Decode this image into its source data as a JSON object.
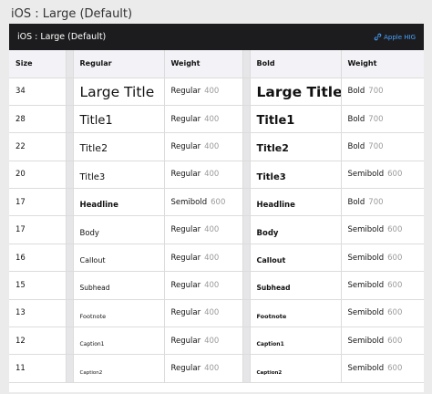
{
  "page_title": "iOS : Large (Default)",
  "header": {
    "title": "iOS : Large (Default)",
    "link_label": "Apple HIG"
  },
  "columns": {
    "size": "Size",
    "regular": "Regular",
    "weight": "Weight",
    "bold": "Bold",
    "bold_weight": "Weight"
  },
  "rows": [
    {
      "size": "34",
      "regular": "Large Title",
      "regular_weight": "Regular",
      "regular_weight_num": "400",
      "bold": "Large Title",
      "bold_weight": "Bold",
      "bold_weight_num": "700"
    },
    {
      "size": "28",
      "regular": "Title1",
      "regular_weight": "Regular",
      "regular_weight_num": "400",
      "bold": "Title1",
      "bold_weight": "Bold",
      "bold_weight_num": "700"
    },
    {
      "size": "22",
      "regular": "Title2",
      "regular_weight": "Regular",
      "regular_weight_num": "400",
      "bold": "Title2",
      "bold_weight": "Bold",
      "bold_weight_num": "700"
    },
    {
      "size": "20",
      "regular": "Title3",
      "regular_weight": "Regular",
      "regular_weight_num": "400",
      "bold": "Title3",
      "bold_weight": "Semibold",
      "bold_weight_num": "600"
    },
    {
      "size": "17",
      "regular": "Headline",
      "regular_weight": "Semibold",
      "regular_weight_num": "600",
      "bold": "Headline",
      "bold_weight": "Bold",
      "bold_weight_num": "700"
    },
    {
      "size": "17",
      "regular": "Body",
      "regular_weight": "Regular",
      "regular_weight_num": "400",
      "bold": "Body",
      "bold_weight": "Semibold",
      "bold_weight_num": "600"
    },
    {
      "size": "16",
      "regular": "Callout",
      "regular_weight": "Regular",
      "regular_weight_num": "400",
      "bold": "Callout",
      "bold_weight": "Semibold",
      "bold_weight_num": "600"
    },
    {
      "size": "15",
      "regular": "Subhead",
      "regular_weight": "Regular",
      "regular_weight_num": "400",
      "bold": "Subhead",
      "bold_weight": "Semibold",
      "bold_weight_num": "600"
    },
    {
      "size": "13",
      "regular": "Footnote",
      "regular_weight": "Regular",
      "regular_weight_num": "400",
      "bold": "Footnote",
      "bold_weight": "Semibold",
      "bold_weight_num": "600"
    },
    {
      "size": "12",
      "regular": "Caption1",
      "regular_weight": "Regular",
      "regular_weight_num": "400",
      "bold": "Caption1",
      "bold_weight": "Semibold",
      "bold_weight_num": "600"
    },
    {
      "size": "11",
      "regular": "Caption2",
      "regular_weight": "Regular",
      "regular_weight_num": "400",
      "bold": "Caption2",
      "bold_weight": "Semibold",
      "bold_weight_num": "600"
    }
  ],
  "colors": {
    "header_bg": "#1c1c1e",
    "link": "#4aa3ff",
    "weight_num": "#9a9a9a",
    "column_header_bg": "#f2f2f7"
  },
  "icons": {
    "link": "link-icon"
  }
}
